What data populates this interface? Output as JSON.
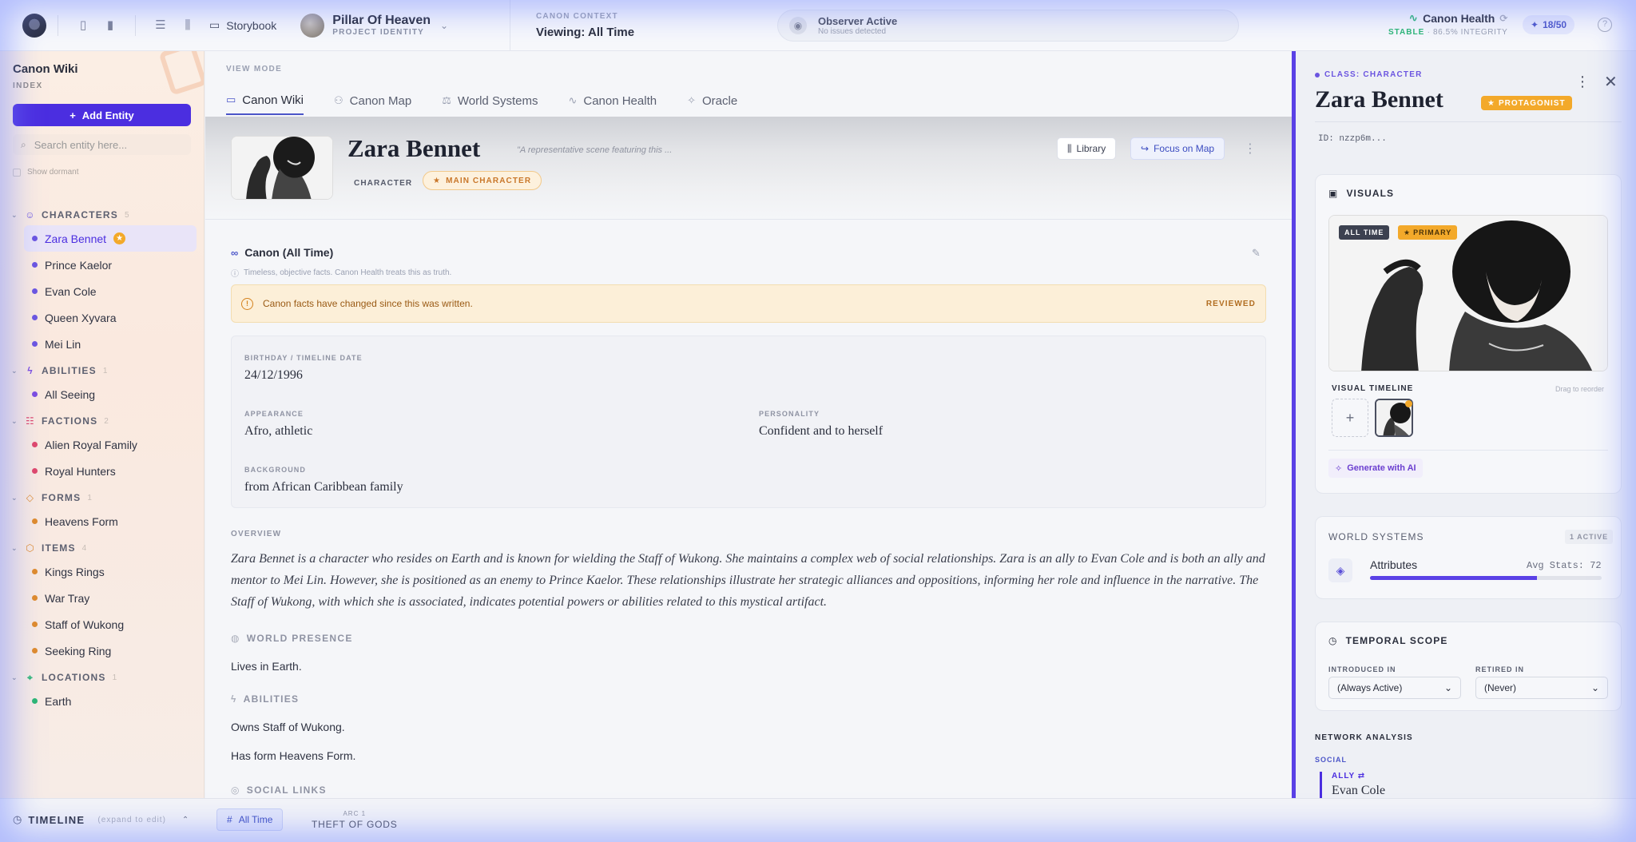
{
  "topbar": {
    "storybook_label": "Storybook",
    "project_name": "Pillar Of Heaven",
    "project_sub": "PROJECT IDENTITY",
    "canon_context_label": "CANON CONTEXT",
    "canon_context_value": "Viewing: All Time",
    "observer_title": "Observer Active",
    "observer_sub": "No issues detected",
    "health_title": "Canon Health",
    "health_status": "STABLE",
    "health_integrity": "86.5% INTEGRITY",
    "counter": "18/50"
  },
  "sidebar": {
    "title": "Canon Wiki",
    "subtitle": "INDEX",
    "add_label": "Add Entity",
    "search_placeholder": "Search entity here...",
    "dormant_label": "Show dormant",
    "sections": [
      {
        "title": "CHARACTERS",
        "count": "5",
        "icon": "user-icon",
        "color": "#6b55e0",
        "items": [
          {
            "label": "Zara Bennet",
            "active": true,
            "color": "#6b55e0"
          },
          {
            "label": "Prince Kaelor",
            "color": "#6b55e0"
          },
          {
            "label": "Evan Cole",
            "color": "#6b55e0"
          },
          {
            "label": "Queen Xyvara",
            "color": "#6b55e0"
          },
          {
            "label": "Mei Lin",
            "color": "#6b55e0"
          }
        ]
      },
      {
        "title": "ABILITIES",
        "count": "1",
        "icon": "bolt-icon",
        "color": "#7c4de0",
        "items": [
          {
            "label": "All Seeing",
            "color": "#7c4de0"
          }
        ]
      },
      {
        "title": "FACTIONS",
        "count": "2",
        "icon": "group-icon",
        "color": "#e0466a",
        "items": [
          {
            "label": "Alien Royal Family",
            "color": "#e0466a"
          },
          {
            "label": "Royal Hunters",
            "color": "#e0466a"
          }
        ]
      },
      {
        "title": "FORMS",
        "count": "1",
        "icon": "shapes-icon",
        "color": "#e08a2a",
        "items": [
          {
            "label": "Heavens Form",
            "color": "#e08a2a"
          }
        ]
      },
      {
        "title": "ITEMS",
        "count": "4",
        "icon": "box-icon",
        "color": "#e08a2a",
        "items": [
          {
            "label": "Kings Rings",
            "color": "#e08a2a"
          },
          {
            "label": "War Tray",
            "color": "#e08a2a"
          },
          {
            "label": "Staff of Wukong",
            "color": "#e08a2a"
          },
          {
            "label": "Seeking Ring",
            "color": "#e08a2a"
          }
        ]
      },
      {
        "title": "LOCATIONS",
        "count": "1",
        "icon": "pin-icon",
        "color": "#2bb673",
        "items": [
          {
            "label": "Earth",
            "color": "#2bb673"
          }
        ]
      }
    ]
  },
  "main": {
    "view_mode_label": "VIEW MODE",
    "tabs": [
      {
        "label": "Canon Wiki",
        "icon": "book-icon",
        "active": true
      },
      {
        "label": "Canon Map",
        "icon": "map-icon"
      },
      {
        "label": "World Systems",
        "icon": "scale-icon"
      },
      {
        "label": "Canon Health",
        "icon": "pulse-icon"
      },
      {
        "label": "Oracle",
        "icon": "sparkle-icon"
      }
    ],
    "entity_name": "Zara Bennet",
    "quote": "\"A representative scene featuring this ...",
    "type_chip": "CHARACTER",
    "role_chip": "MAIN CHARACTER",
    "library_label": "Library",
    "focus_label": "Focus on Map",
    "canon_title": "Canon (All Time)",
    "canon_sub": "Timeless, objective facts. Canon Health treats this as truth.",
    "warning_text": "Canon facts have changed since this was written.",
    "warning_action": "REVIEWED",
    "facts": {
      "birthday_label": "BIRTHDAY / TIMELINE DATE",
      "birthday_value": "24/12/1996",
      "appearance_label": "APPEARANCE",
      "appearance_value": "Afro, athletic",
      "personality_label": "PERSONALITY",
      "personality_value": "Confident and to herself",
      "background_label": "BACKGROUND",
      "background_value": "from African Caribbean family"
    },
    "overview_label": "OVERVIEW",
    "overview_text": "Zara Bennet is a character who resides on Earth and is known for wielding the Staff of Wukong. She maintains a complex web of social relationships. Zara is an ally to Evan Cole and is both an ally and mentor to Mei Lin. However, she is positioned as an enemy to Prince Kaelor. These relationships illustrate her strategic alliances and oppositions, informing her role and influence in the narrative. The Staff of Wukong, with which she is associated, indicates potential powers or abilities related to this mystical artifact.",
    "world_presence_label": "WORLD PRESENCE",
    "world_presence_text": "Lives in Earth.",
    "abilities_label": "ABILITIES",
    "abilities_text_1": "Owns Staff of Wukong.",
    "abilities_text_2": "Has form Heavens Form.",
    "social_links_label": "SOCIAL LINKS"
  },
  "panel": {
    "class_label": "CLASS: CHARACTER",
    "name": "Zara Bennet",
    "protagonist": "PROTAGONIST",
    "id": "ID: nzzp6m...",
    "visuals_label": "VISUALS",
    "badge_all_time": "ALL TIME",
    "badge_primary": "PRIMARY",
    "visual_timeline_label": "VISUAL TIMELINE",
    "drag_hint": "Drag to reorder",
    "generate_label": "Generate with AI",
    "world_systems_label": "WORLD SYSTEMS",
    "world_systems_active": "1 ACTIVE",
    "attr_name": "Attributes",
    "attr_stat": "Avg Stats: 72",
    "attr_fill": 0.72,
    "temporal_label": "TEMPORAL SCOPE",
    "introduced_label": "INTRODUCED IN",
    "introduced_value": "(Always Active)",
    "retired_label": "RETIRED IN",
    "retired_value": "(Never)",
    "network_label": "NETWORK ANALYSIS",
    "social_label": "SOCIAL",
    "ally_label": "ALLY",
    "ally_name": "Evan Cole"
  },
  "timeline": {
    "title": "TIMELINE",
    "hint": "(expand to edit)",
    "all_time": "All Time",
    "arc_label": "ARC 1",
    "arc_name": "THEFT OF GODS"
  }
}
